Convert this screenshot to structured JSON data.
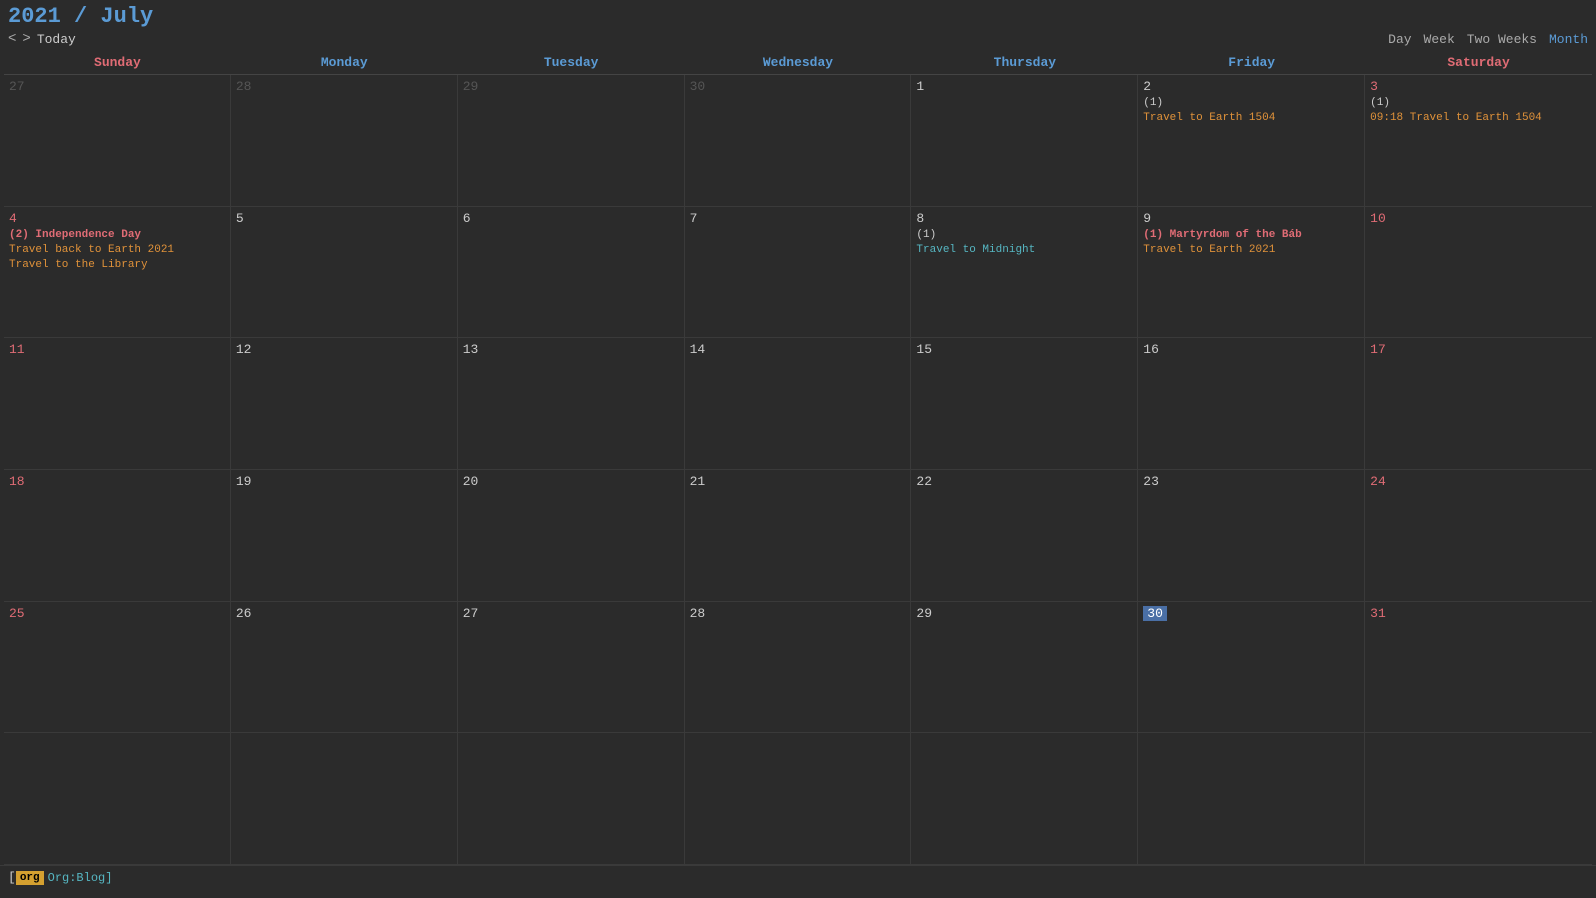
{
  "header": {
    "year": "2021",
    "slash": " / ",
    "month": "July",
    "prev_label": "<",
    "next_label": ">",
    "today_label": "Today"
  },
  "views": {
    "day": "Day",
    "week": "Week",
    "two_weeks": "Two Weeks",
    "month": "Month"
  },
  "day_headers": [
    "Sunday",
    "Monday",
    "Tuesday",
    "Wednesday",
    "Thursday",
    "Friday",
    "Saturday"
  ],
  "weeks": [
    [
      {
        "num": "27",
        "type": "other"
      },
      {
        "num": "28",
        "type": "other"
      },
      {
        "num": "29",
        "type": "other"
      },
      {
        "num": "30",
        "type": "other"
      },
      {
        "num": "1",
        "type": "normal"
      },
      {
        "num": "2",
        "type": "normal",
        "events": [
          {
            "text": "(1)",
            "cls": "count"
          },
          {
            "text": "Travel to Earth 1504",
            "cls": "orange"
          }
        ]
      },
      {
        "num": "3",
        "type": "weekend",
        "events": [
          {
            "text": "(1)",
            "cls": "count"
          },
          {
            "text": "09:18 Travel to Earth 1504",
            "cls": "orange"
          }
        ]
      }
    ],
    [
      {
        "num": "4",
        "type": "weekend",
        "events": [
          {
            "text": "(2)  Independence Day",
            "cls": "bold-orange"
          },
          {
            "text": "Travel back to Earth 2021",
            "cls": "orange"
          },
          {
            "text": "Travel to the Library",
            "cls": "orange"
          }
        ]
      },
      {
        "num": "5",
        "type": "normal"
      },
      {
        "num": "6",
        "type": "normal"
      },
      {
        "num": "7",
        "type": "normal"
      },
      {
        "num": "8",
        "type": "normal",
        "events": [
          {
            "text": "(1)",
            "cls": "count"
          },
          {
            "text": "Travel to Midnight",
            "cls": "cyan"
          }
        ]
      },
      {
        "num": "9",
        "type": "normal",
        "events": [
          {
            "text": "(1)  Martyrdom of the Báb",
            "cls": "bold-orange"
          },
          {
            "text": "Travel to Earth 2021",
            "cls": "orange"
          }
        ]
      },
      {
        "num": "10",
        "type": "weekend"
      }
    ],
    [
      {
        "num": "11",
        "type": "weekend"
      },
      {
        "num": "12",
        "type": "normal"
      },
      {
        "num": "13",
        "type": "normal"
      },
      {
        "num": "14",
        "type": "normal"
      },
      {
        "num": "15",
        "type": "normal"
      },
      {
        "num": "16",
        "type": "normal"
      },
      {
        "num": "17",
        "type": "weekend"
      }
    ],
    [
      {
        "num": "18",
        "type": "weekend"
      },
      {
        "num": "19",
        "type": "normal"
      },
      {
        "num": "20",
        "type": "normal"
      },
      {
        "num": "21",
        "type": "normal"
      },
      {
        "num": "22",
        "type": "normal"
      },
      {
        "num": "23",
        "type": "normal"
      },
      {
        "num": "24",
        "type": "weekend"
      }
    ],
    [
      {
        "num": "25",
        "type": "weekend"
      },
      {
        "num": "26",
        "type": "normal"
      },
      {
        "num": "27",
        "type": "normal"
      },
      {
        "num": "28",
        "type": "normal"
      },
      {
        "num": "29",
        "type": "normal"
      },
      {
        "num": "30",
        "type": "today"
      },
      {
        "num": "31",
        "type": "weekend"
      }
    ],
    [
      {
        "num": "",
        "type": "empty"
      },
      {
        "num": "",
        "type": "empty"
      },
      {
        "num": "",
        "type": "empty"
      },
      {
        "num": "",
        "type": "empty"
      },
      {
        "num": "",
        "type": "empty"
      },
      {
        "num": "",
        "type": "empty"
      },
      {
        "num": "",
        "type": "empty"
      }
    ]
  ],
  "footer": {
    "tag": "org",
    "text": "Org:Blog]"
  }
}
